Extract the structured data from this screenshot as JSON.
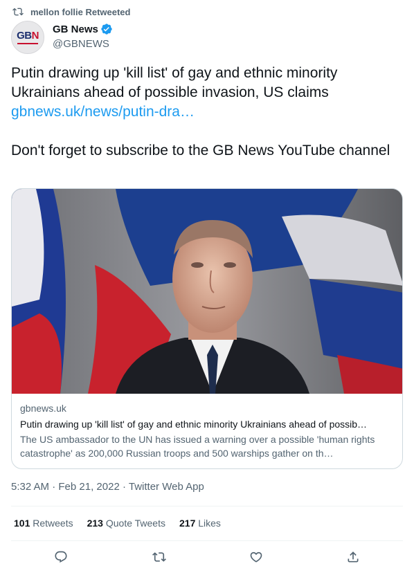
{
  "retweet": {
    "text": "mellon follie Retweeted",
    "icon": "retweet-icon"
  },
  "author": {
    "avatar_logo": "GBN",
    "display_name": "GB News",
    "handle": "@GBNEWS",
    "verified": true,
    "verified_icon": "verified-badge-icon"
  },
  "tweet": {
    "text_1": "Putin drawing up 'kill list' of gay and ethnic minority Ukrainians ahead of possible invasion, US claims",
    "link": "gbnews.uk/news/putin-dra…",
    "text_2": "Don't forget to subscribe to the GB News YouTube channel"
  },
  "card": {
    "image_description_icon": "article-photo",
    "domain": "gbnews.uk",
    "title": "Putin drawing up 'kill list' of gay and ethnic minority Ukrainians ahead of possib…",
    "description": "The US ambassador to the UN has issued a warning over a possible 'human rights catastrophe' as 200,000 Russian troops and 500 warships gather on th…"
  },
  "meta": {
    "time": "5:32 AM",
    "separator": "·",
    "date": "Feb 21, 2022",
    "client": "Twitter Web App"
  },
  "stats": {
    "retweets_count": "101",
    "retweets_label": "Retweets",
    "quotes_count": "213",
    "quotes_label": "Quote Tweets",
    "likes_count": "217",
    "likes_label": "Likes"
  },
  "actions": {
    "reply_icon": "reply-icon",
    "retweet_icon": "retweet-icon",
    "like_icon": "heart-icon",
    "share_icon": "share-icon"
  },
  "colors": {
    "accent": "#1d9bf0",
    "text_primary": "#0f1419",
    "text_secondary": "#536471",
    "border": "#cfd9de"
  }
}
